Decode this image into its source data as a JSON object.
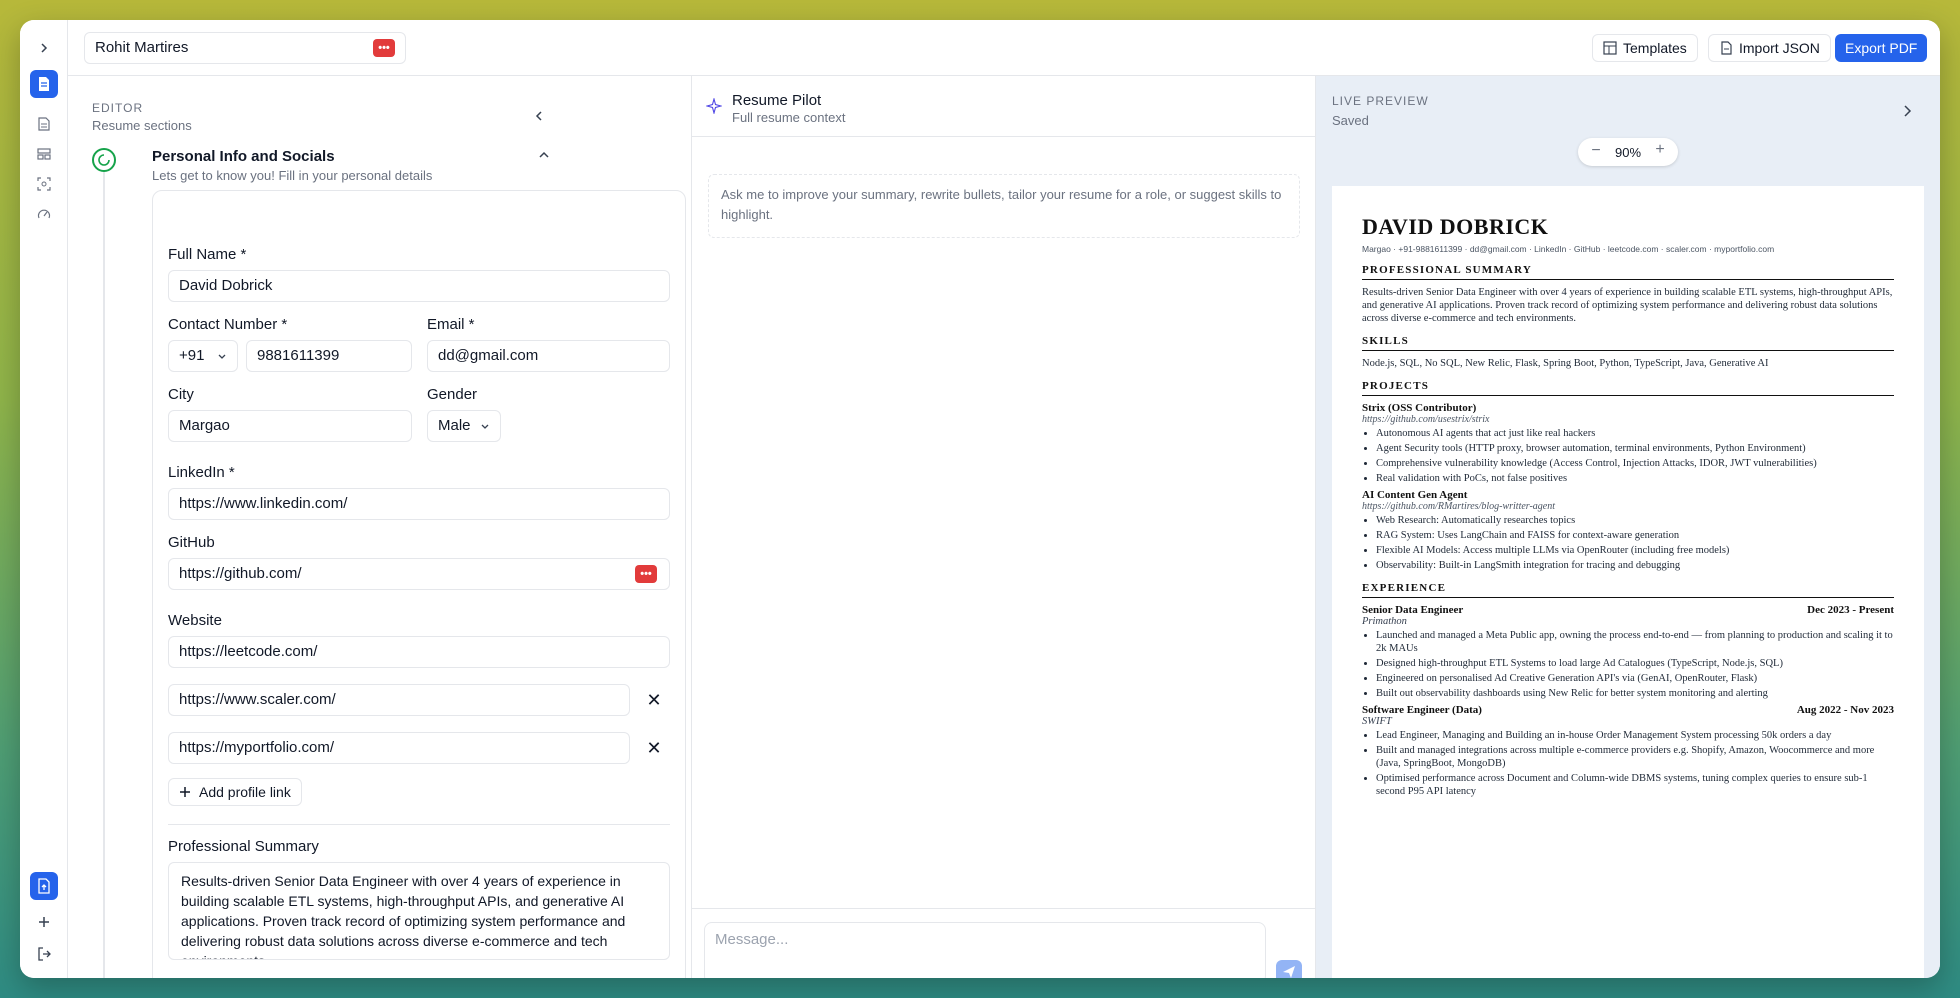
{
  "topbar": {
    "resume_name": "Rohit Martires",
    "templates_label": "Templates",
    "import_label": "Import JSON",
    "export_label": "Export PDF"
  },
  "editor": {
    "header": "EDITOR",
    "subheader": "Resume sections",
    "section_title": "Personal Info and Socials",
    "section_subtitle": "Lets get to know you! Fill in your personal details",
    "full_name_label": "Full Name *",
    "full_name": "David Dobrick",
    "contact_label": "Contact Number *",
    "country_code": "+91",
    "phone": "9881611399",
    "email_label": "Email *",
    "email": "dd@gmail.com",
    "city_label": "City",
    "city": "Margao",
    "gender_label": "Gender",
    "gender": "Male",
    "linkedin_label": "LinkedIn *",
    "linkedin": "https://www.linkedin.com/",
    "github_label": "GitHub",
    "github": "https://github.com/",
    "website_label": "Website",
    "website": "https://leetcode.com/",
    "extra_links": [
      "https://www.scaler.com/",
      "https://myportfolio.com/"
    ],
    "add_link_label": "Add profile link",
    "summary_label": "Professional Summary",
    "summary": "Results-driven Senior Data Engineer with over 4 years of experience in building scalable ETL systems, high-throughput APIs, and generative AI applications. Proven track record of optimizing system performance and delivering robust data solutions across diverse e-commerce and tech environments."
  },
  "chat": {
    "title": "Resume Pilot",
    "subtitle": "Full resume context",
    "hint": "Ask me to improve your summary, rewrite bullets, tailor your resume for a role, or suggest skills to highlight.",
    "message_placeholder": "Message..."
  },
  "preview": {
    "header": "LIVE PREVIEW",
    "status": "Saved",
    "zoom": "90%"
  },
  "resume": {
    "name": "DAVID DOBRICK",
    "contact": "Margao · +91-9881611399 · dd@gmail.com · LinkedIn · GitHub · leetcode.com · scaler.com · myportfolio.com",
    "summary_title": "PROFESSIONAL SUMMARY",
    "summary": "Results-driven Senior Data Engineer with over 4 years of experience in building scalable ETL systems, high-throughput APIs, and generative AI applications. Proven track record of optimizing system performance and delivering robust data solutions across diverse e-commerce and tech environments.",
    "skills_title": "SKILLS",
    "skills": "Node.js, SQL, No SQL, New Relic, Flask, Spring Boot, Python, TypeScript, Java, Generative AI",
    "projects_title": "PROJECTS",
    "projects": [
      {
        "name": "Strix (OSS Contributor)",
        "link": "https://github.com/usestrix/strix",
        "bullets": [
          "Autonomous AI agents that act just like real hackers",
          "Agent Security tools (HTTP proxy, browser automation, terminal environments, Python Environment)",
          "Comprehensive vulnerability knowledge (Access Control, Injection Attacks, IDOR, JWT vulnerabilities)",
          "Real validation with PoCs, not false positives"
        ]
      },
      {
        "name": "AI Content Gen Agent",
        "link": "https://github.com/RMartires/blog-writter-agent",
        "bullets": [
          "Web Research: Automatically researches topics",
          "RAG System: Uses LangChain and FAISS for context-aware generation",
          "Flexible AI Models: Access multiple LLMs via OpenRouter (including free models)",
          "Observability: Built-in LangSmith integration for tracing and debugging"
        ]
      }
    ],
    "experience_title": "EXPERIENCE",
    "jobs": [
      {
        "title": "Senior Data Engineer",
        "dates": "Dec 2023 - Present",
        "company": "Primathon",
        "bullets": [
          "Launched and managed a Meta Public app, owning the process end-to-end — from planning to production and scaling it to 2k MAUs",
          "Designed high-throughput ETL Systems to load large Ad Catalogues (TypeScript, Node.js, SQL)",
          "Engineered on personalised Ad Creative Generation API's via (GenAI, OpenRouter, Flask)",
          "Built out observability dashboards using New Relic for better system monitoring and alerting"
        ]
      },
      {
        "title": "Software Engineer (Data)",
        "dates": "Aug 2022 - Nov 2023",
        "company": "SWIFT",
        "bullets": [
          "Lead Engineer, Managing and Building an in-house Order Management System processing 50k orders a day",
          "Built and managed integrations across multiple e-commerce providers e.g. Shopify, Amazon, Woocommerce and more (Java, SpringBoot, MongoDB)",
          "Optimised performance across Document and Column-wide DBMS systems, tuning complex queries to ensure sub-1 second P95 API latency"
        ]
      }
    ]
  }
}
